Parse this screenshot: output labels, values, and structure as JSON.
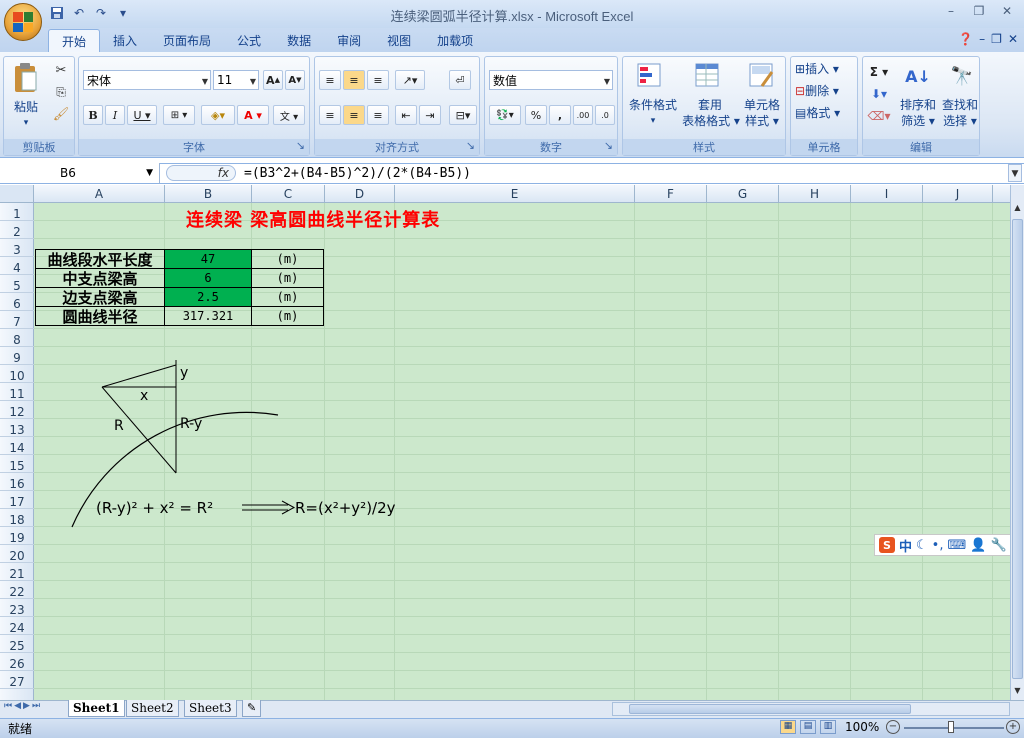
{
  "window": {
    "title": "连续梁圆弧半径计算.xlsx - Microsoft Excel"
  },
  "tabs": [
    {
      "label": "开始",
      "active": true
    },
    {
      "label": "插入"
    },
    {
      "label": "页面布局"
    },
    {
      "label": "公式"
    },
    {
      "label": "数据"
    },
    {
      "label": "审阅"
    },
    {
      "label": "视图"
    },
    {
      "label": "加载项"
    }
  ],
  "ribbon": {
    "clipboard": {
      "label": "剪贴板",
      "paste": "粘贴"
    },
    "font": {
      "label": "字体",
      "name": "宋体",
      "size": "11"
    },
    "alignment": {
      "label": "对齐方式"
    },
    "number": {
      "label": "数字",
      "format": "数值"
    },
    "styles": {
      "label": "样式",
      "conditional": "条件格式",
      "table1": "套用",
      "table2": "表格格式",
      "cell1": "单元格",
      "cell2": "样式"
    },
    "cells": {
      "label": "单元格",
      "insert": "插入",
      "delete": "删除",
      "format": "格式"
    },
    "editing": {
      "label": "编辑",
      "sort1": "排序和",
      "sort2": "筛选",
      "find1": "查找和",
      "find2": "选择"
    }
  },
  "formula_bar": {
    "name_box": "B6",
    "fx": "fx",
    "formula": "=(B3^2+(B4-B5)^2)/(2*(B4-B5))"
  },
  "columns": [
    "A",
    "B",
    "C",
    "D",
    "E",
    "F",
    "G",
    "H",
    "I",
    "J"
  ],
  "rows": [
    "1",
    "2",
    "3",
    "4",
    "5",
    "6",
    "7",
    "8",
    "9",
    "10",
    "11",
    "12",
    "13",
    "14",
    "15",
    "16",
    "17",
    "18",
    "19",
    "20",
    "21",
    "22",
    "23",
    "24",
    "25",
    "26",
    "27"
  ],
  "sheet": {
    "title": "连续梁  梁高圆曲线半径计算表",
    "table": [
      {
        "label": "曲线段水平长度",
        "value": "47",
        "unit": "(m)",
        "green": true
      },
      {
        "label": "中支点梁高",
        "value": "6",
        "unit": "(m)",
        "green": true
      },
      {
        "label": "边支点梁高",
        "value": "2.5",
        "unit": "(m)",
        "green": true
      },
      {
        "label": "圆曲线半径",
        "value": "317.321",
        "unit": "(m)",
        "green": false
      }
    ],
    "diagram": {
      "y": "y",
      "x": "x",
      "R": "R",
      "Ry": "R-y",
      "eq1": "(R-y)² + x² = R²",
      "eq2": "R=(x²+y²)/2y"
    }
  },
  "sheet_tabs": [
    "Sheet1",
    "Sheet2",
    "Sheet3"
  ],
  "status": {
    "ready": "就绪",
    "zoom": "100%"
  },
  "ime": {
    "label": "中"
  },
  "colors": {
    "accent": "#15428b",
    "grid_bg": "#cce8cc",
    "green_cell": "#00b050",
    "title_red": "#ff0000"
  }
}
